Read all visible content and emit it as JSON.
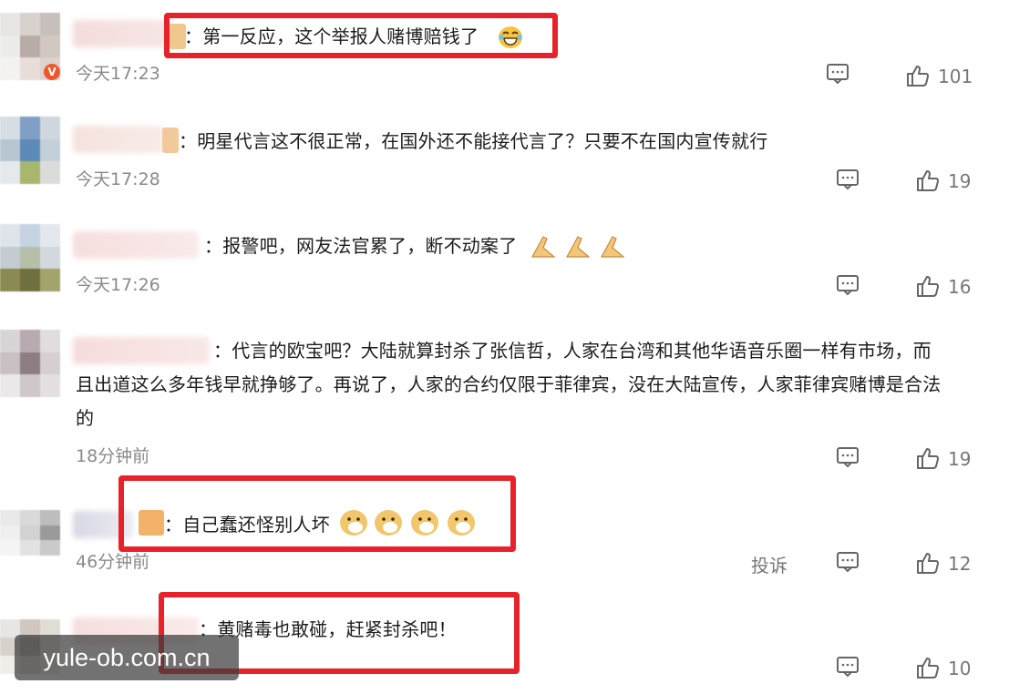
{
  "comments": [
    {
      "text": "：第一反应，这个举报人赌博赔钱了",
      "time": "今天17:23",
      "likes": "101",
      "emoji": "laugh-cry-emoji"
    },
    {
      "text": "：明星代言这不很正常，在国外还不能接代言了？只要不在国内宣传就行",
      "time": "今天17:28",
      "likes": "19"
    },
    {
      "text": "：报警吧，网友法官累了，断不动案了",
      "time": "今天17:26",
      "likes": "16",
      "emoji": "folded-hands-emoji"
    },
    {
      "text_line1": "：代言的欧宝吧？大陆就算封杀了张信哲，人家在台湾和其他华语音乐圈一样有市场，而",
      "text_line2": "且出道这么多年钱早就挣够了。再说了，人家的合约仅限于菲律宾，没在大陆宣传，人家菲律宾赌博是合法",
      "text_line3": "的",
      "time": "18分钟前",
      "likes": "19"
    },
    {
      "text": "：自己蠢还怪别人坏",
      "time": "46分钟前",
      "likes": "12",
      "report": "投诉",
      "emoji": "doge-emoji"
    },
    {
      "text": "：黄赌毒也敢碰，赶紧封杀吧！",
      "likes": "10"
    }
  ],
  "badge": "V",
  "watermark": "yule-ob.com.cn",
  "colors": {
    "highlight": "#e8222a",
    "meta": "#8a8a8a"
  }
}
